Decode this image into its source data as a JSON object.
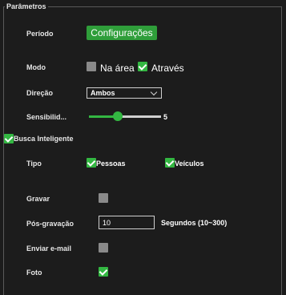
{
  "group": {
    "title": "Parâmetros"
  },
  "periodo": {
    "label": "Período",
    "button": "Configurações"
  },
  "modo": {
    "label": "Modo",
    "options": [
      {
        "label": "Na área",
        "checked": false
      },
      {
        "label": "Através",
        "checked": true
      }
    ]
  },
  "direcao": {
    "label": "Direção",
    "value": "Ambos"
  },
  "sensibilidade": {
    "label": "Sensibilid...",
    "value": "5",
    "level_fraction": 0.4
  },
  "busca": {
    "label": "Busca Inteligente",
    "checked": true
  },
  "tipo": {
    "label": "Tipo",
    "options": [
      {
        "label": "Pessoas",
        "checked": true
      },
      {
        "label": "Veículos",
        "checked": true
      }
    ]
  },
  "gravar": {
    "label": "Gravar",
    "checked": false
  },
  "pos_gravacao": {
    "label": "Pós-gravação",
    "value": "10",
    "unit": "Segundos (10~300)"
  },
  "email": {
    "label": "Enviar e-mail",
    "checked": false
  },
  "foto": {
    "label": "Foto",
    "checked": true
  },
  "colors": {
    "accent": "#33b742",
    "background": "#1c1c1c",
    "unchecked": "#8a8a8a"
  }
}
